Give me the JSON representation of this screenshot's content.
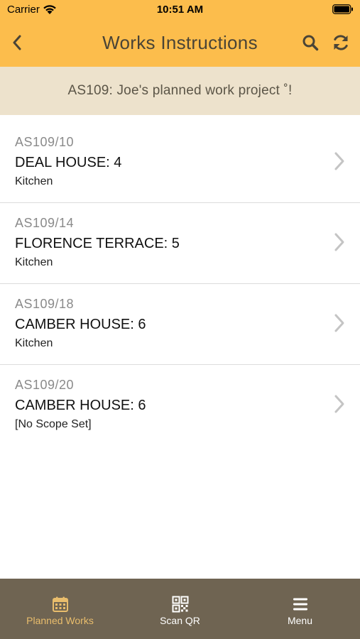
{
  "status_bar": {
    "carrier": "Carrier",
    "time": "10:51 AM"
  },
  "nav": {
    "title": "Works Instructions",
    "icons": [
      "back-chevron-icon",
      "search-icon",
      "refresh-icon"
    ]
  },
  "banner": {
    "text": "AS109: Joe's planned work project ˚!"
  },
  "list": {
    "items": [
      {
        "ref": "AS109/10",
        "title": "DEAL HOUSE: 4",
        "subtitle": "Kitchen"
      },
      {
        "ref": "AS109/14",
        "title": "FLORENCE TERRACE: 5",
        "subtitle": "Kitchen"
      },
      {
        "ref": "AS109/18",
        "title": "CAMBER HOUSE: 6",
        "subtitle": "Kitchen"
      },
      {
        "ref": "AS109/20",
        "title": "CAMBER HOUSE: 6",
        "subtitle": "[No Scope Set]"
      }
    ]
  },
  "tab_bar": {
    "tabs": [
      {
        "label": "Planned Works",
        "icon": "calendar-icon",
        "active": true
      },
      {
        "label": "Scan QR",
        "icon": "qr-code-icon",
        "active": false
      },
      {
        "label": "Menu",
        "icon": "hamburger-menu-icon",
        "active": false
      }
    ]
  },
  "colors": {
    "header": "#fcbd4c",
    "banner": "#ede2cc",
    "tab_bar": "#6f6452",
    "tab_active": "#e9bd6c"
  }
}
